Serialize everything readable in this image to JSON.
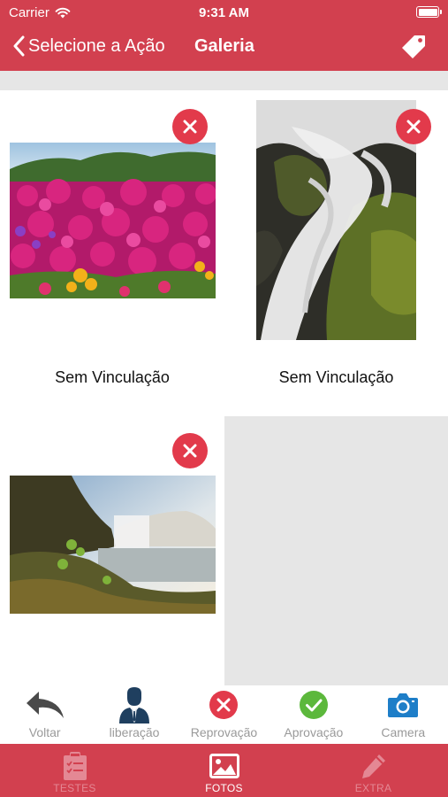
{
  "status_bar": {
    "carrier": "Carrier",
    "time": "9:31 AM"
  },
  "nav": {
    "back_label": "Selecione a Ação",
    "title": "Galeria"
  },
  "gallery": {
    "items": [
      {
        "caption": "Sem Vinculação",
        "image": "pink-flower-field-photo"
      },
      {
        "caption": "Sem Vinculação",
        "image": "waterfall-rocks-photo"
      },
      {
        "caption": "",
        "image": "waterfall-landscape-photo"
      }
    ]
  },
  "actions": [
    {
      "label": "Voltar",
      "icon": "undo-arrow-icon"
    },
    {
      "label": "liberação",
      "icon": "person-suit-icon"
    },
    {
      "label": "Reprovação",
      "icon": "red-x-circle-icon"
    },
    {
      "label": "Aprovação",
      "icon": "green-check-circle-icon"
    },
    {
      "label": "Camera",
      "icon": "camera-icon"
    }
  ],
  "tabs": [
    {
      "label": "TESTES",
      "icon": "clipboard-icon",
      "active": false
    },
    {
      "label": "FOTOS",
      "icon": "image-icon",
      "active": true
    },
    {
      "label": "EXTRA",
      "icon": "pencil-icon",
      "active": false
    }
  ],
  "colors": {
    "brand": "#d2404f",
    "remove": "#e23a4b",
    "approve": "#5cb83c",
    "camera": "#1e7ec8"
  }
}
